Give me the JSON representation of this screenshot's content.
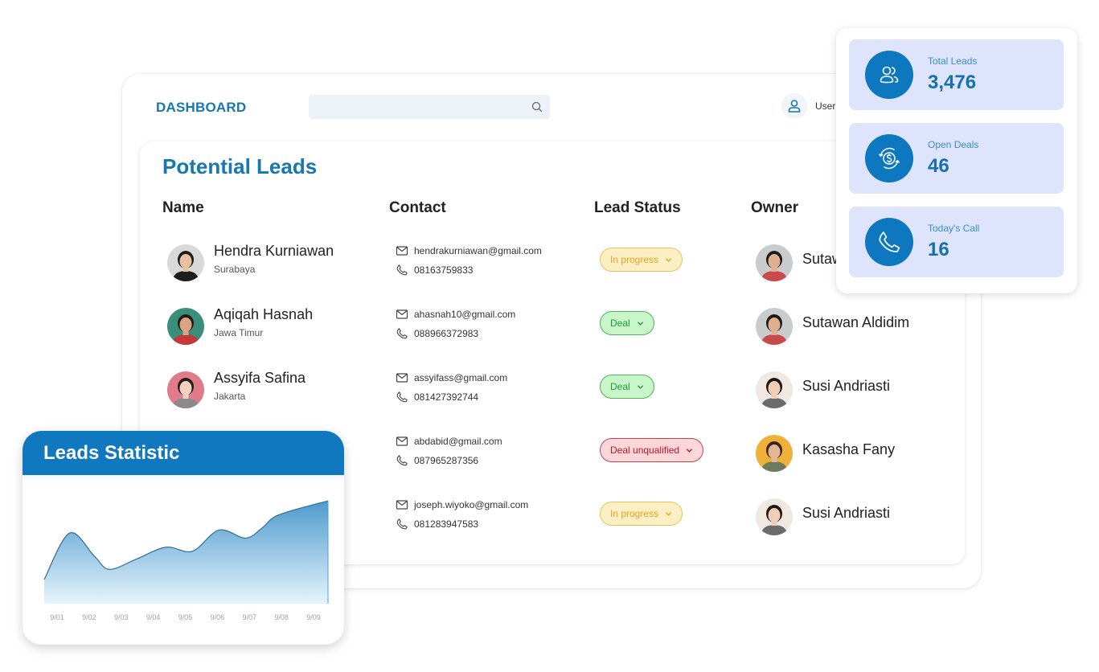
{
  "colors": {
    "brand": "#1778ad",
    "stat_bg": "#dde4fb",
    "stat_icon_bg": "#0d78bf",
    "stat_label": "#3b8fc8",
    "stat_value": "#1670ab",
    "chart_header": "#0f78bf",
    "chart_line": "#2f6e95",
    "chart_fill_top": "#4e9acd",
    "chart_fill_bottom": "#e6f4fc"
  },
  "header": {
    "title": "DASHBOARD",
    "search": {
      "placeholder": "",
      "value": "",
      "icon": "search-icon"
    },
    "user": {
      "label": "User",
      "icon": "user-icon"
    }
  },
  "leads": {
    "title": "Potential Leads",
    "columns": [
      "Name",
      "Contact",
      "Lead Status",
      "Owner"
    ],
    "rows": [
      {
        "name": "Hendra Kurniawan",
        "city": "Surabaya",
        "email": "hendrakurniawan@gmail.com",
        "phone": "08163759833",
        "status": "In progress",
        "owner": "Sutawan Aldidim",
        "owner_visible": "Sutaw"
      },
      {
        "name": "Aqiqah Hasnah",
        "city": "Jawa Timur",
        "email": "ahasnah10@gmail.com",
        "phone": "088966372983",
        "status": "Deal",
        "owner": "Sutawan Aldidim"
      },
      {
        "name": "Assyifa Safina",
        "city": "Jakarta",
        "email": "assyifass@gmail.com",
        "phone": "081427392744",
        "status": "Deal",
        "owner": "Susi Andriasti"
      },
      {
        "name": "",
        "city": "",
        "email": "abdabid@gmail.com",
        "phone": "087965287356",
        "status": "Deal unqualified",
        "owner": "Kasasha Fany"
      },
      {
        "name": "",
        "city": "",
        "email": "joseph.wiyoko@gmail.com",
        "phone": "081283947583",
        "status": "In progress",
        "owner": "Susi Andriasti"
      }
    ],
    "status_styles": {
      "In progress": {
        "bg": "#fdefc4",
        "border": "#e8c15a",
        "text": "#e1a220"
      },
      "Deal": {
        "bg": "#c8f6c8",
        "border": "#4cb45a",
        "text": "#1f9a3a"
      },
      "Deal unqualified": {
        "bg": "#fdd6d9",
        "border": "#c8414f",
        "text": "#b5182c"
      }
    }
  },
  "stats": [
    {
      "label": "Total Leads",
      "value": "3,476",
      "icon": "users-icon"
    },
    {
      "label": "Open Deals",
      "value": "46",
      "icon": "dollar-cycle-icon"
    },
    {
      "label": "Today's Call",
      "value": "16",
      "icon": "phone-icon"
    }
  ],
  "chart_data": {
    "type": "area",
    "title": "Leads Statistic",
    "categories": [
      "9/01",
      "9/02",
      "9/03",
      "9/04",
      "9/05",
      "9/06",
      "9/07",
      "9/08",
      "9/09"
    ],
    "x": [
      0,
      0.5,
      1,
      1.5,
      2,
      2.5,
      3,
      3.5,
      4,
      4.5,
      5,
      5.5,
      6,
      6.5,
      7,
      7.5,
      8,
      8.5
    ],
    "values": [
      34,
      72,
      60,
      50,
      38,
      44,
      52,
      58,
      58,
      56,
      70,
      74,
      64,
      88,
      100
    ],
    "series": [
      {
        "name": "Leads",
        "points": [
          [
            -0.1,
            24
          ],
          [
            0.4,
            70
          ],
          [
            1.15,
            47
          ],
          [
            1.6,
            34
          ],
          [
            2.4,
            44
          ],
          [
            3.3,
            56
          ],
          [
            4.1,
            52
          ],
          [
            4.9,
            73
          ],
          [
            5.7,
            65
          ],
          [
            6.2,
            75
          ],
          [
            6.7,
            88
          ],
          [
            7.8,
            102
          ]
        ]
      }
    ],
    "xlabel": "",
    "ylabel": "",
    "ylim": [
      0,
      110
    ],
    "grid": false,
    "legend": "none",
    "y_axis_visible": false
  }
}
